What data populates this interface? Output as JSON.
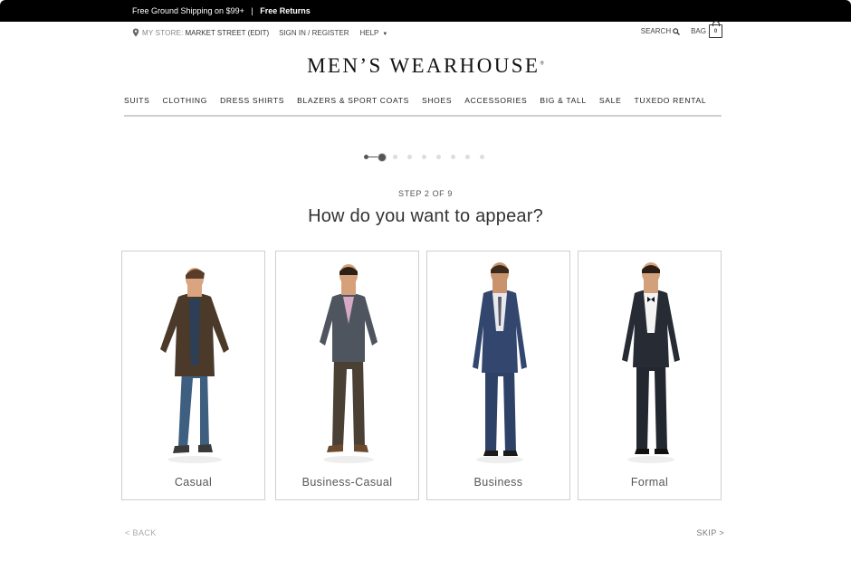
{
  "promo": {
    "shipping": "Free Ground Shipping on $99+",
    "separator": "|",
    "returns": "Free Returns"
  },
  "utility": {
    "my_store_label": "MY STORE:",
    "store_name": "MARKET STREET (EDIT)",
    "sign_in": "SIGN IN / REGISTER",
    "help": "HELP",
    "search": "SEARCH",
    "bag": "BAG",
    "bag_count": "0"
  },
  "logo": {
    "text": "MEN’S WEARHOUSE",
    "mark": "®"
  },
  "nav": [
    "SUITS",
    "CLOTHING",
    "DRESS SHIRTS",
    "BLAZERS & SPORT COATS",
    "SHOES",
    "ACCESSORIES",
    "BIG & TALL",
    "SALE",
    "TUXEDO RENTAL"
  ],
  "progress": {
    "current_step": 2,
    "total_steps": 9
  },
  "step_label": "STEP 2 OF 9",
  "question": "How do you want to appear?",
  "options": [
    {
      "label": "Casual"
    },
    {
      "label": "Business-Casual"
    },
    {
      "label": "Business"
    },
    {
      "label": "Formal"
    }
  ],
  "footer": {
    "back": "< BACK",
    "skip": "SKIP >"
  },
  "colors": {
    "promo_bg": "#000000",
    "text": "#333333",
    "border": "#cfcfcf",
    "inactive_dot": "#dddddd"
  }
}
